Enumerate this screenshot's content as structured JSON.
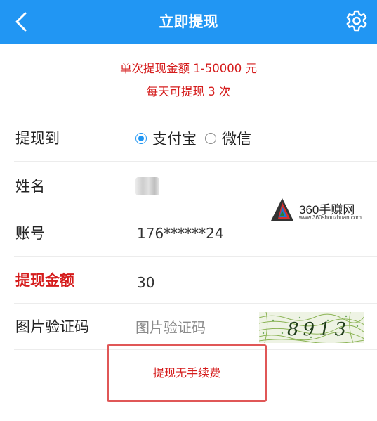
{
  "header": {
    "title": "立即提现",
    "back_icon": "chevron-left-icon",
    "settings_icon": "gear-icon",
    "bg_color": "#2196f3"
  },
  "notice": {
    "line1": "单次提现金额 1-50000 元",
    "line2": "每天可提现 3 次",
    "color": "#d51c1c"
  },
  "form": {
    "withdraw_to": {
      "label": "提现到",
      "options": [
        {
          "label": "支付宝",
          "checked": true
        },
        {
          "label": "微信",
          "checked": false
        }
      ]
    },
    "name": {
      "label": "姓名"
    },
    "account": {
      "label": "账号",
      "value": "176******24"
    },
    "amount": {
      "label": "提现金额",
      "value": "30"
    },
    "captcha": {
      "label": "图片验证码",
      "placeholder": "图片验证码",
      "image_text": "8913"
    }
  },
  "fee_note": "提现无手续费",
  "watermark": {
    "brand": "360手赚网",
    "url": "www.360shouzhuan.com"
  }
}
